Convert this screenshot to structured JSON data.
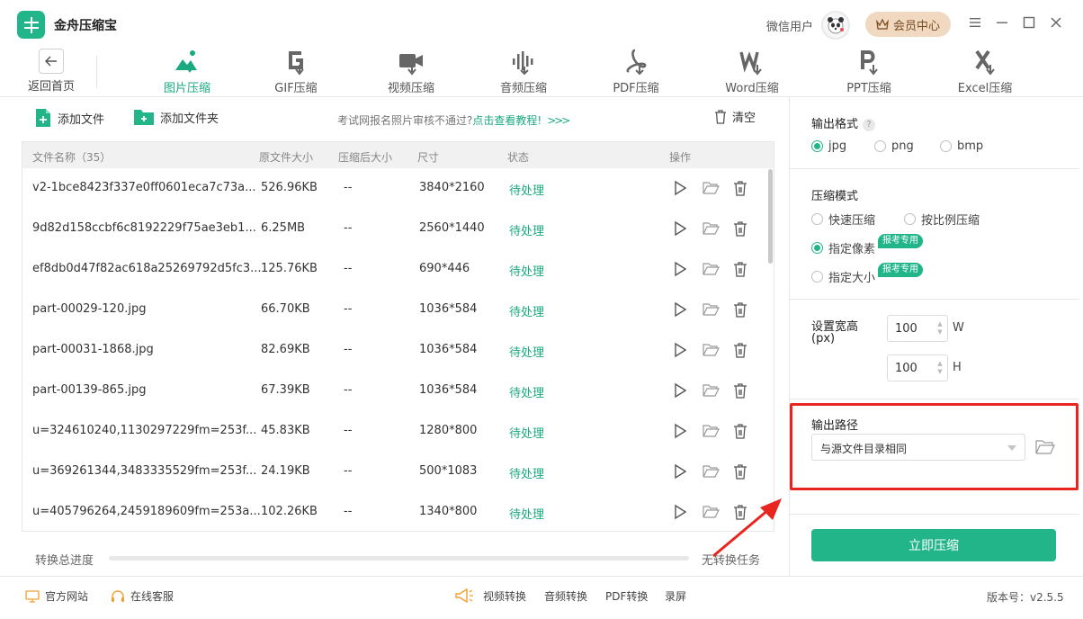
{
  "app": {
    "title": "金舟压缩宝",
    "user_name": "微信用户",
    "vip_label": "会员中心"
  },
  "nav": {
    "back_label": "返回首页",
    "tabs": [
      {
        "label": "图片压缩",
        "icon": "image-compress-icon",
        "active": true
      },
      {
        "label": "GIF压缩",
        "icon": "gif-compress-icon"
      },
      {
        "label": "视频压缩",
        "icon": "video-compress-icon"
      },
      {
        "label": "音频压缩",
        "icon": "audio-compress-icon"
      },
      {
        "label": "PDF压缩",
        "icon": "pdf-compress-icon"
      },
      {
        "label": "Word压缩",
        "icon": "word-compress-icon"
      },
      {
        "label": "PPT压缩",
        "icon": "ppt-compress-icon"
      },
      {
        "label": "Excel压缩",
        "icon": "excel-compress-icon"
      }
    ]
  },
  "toolbar": {
    "add_file": "添加文件",
    "add_folder": "添加文件夹",
    "notice_text": "考试网报名照片审核不通过?",
    "notice_link": "点击查看教程!",
    "notice_arrows": ">>>",
    "clear": "清空"
  },
  "table": {
    "headers": {
      "name": "文件名称（35）",
      "original_size": "原文件大小",
      "compressed_size": "压缩后大小",
      "dimensions": "尺寸",
      "status": "状态",
      "actions": "操作"
    },
    "rows": [
      {
        "name": "v2-1bce8423f337e0ff0601eca7c73a...",
        "original_size": "526.96KB",
        "compressed_size": "--",
        "dimensions": "3840*2160",
        "status": "待处理"
      },
      {
        "name": "9d82d158ccbf6c8192229f75ae3eb1...",
        "original_size": "6.25MB",
        "compressed_size": "--",
        "dimensions": "2560*1440",
        "status": "待处理"
      },
      {
        "name": "ef8db0d47f82ac618a25269792d5fc3...",
        "original_size": "125.76KB",
        "compressed_size": "--",
        "dimensions": "690*446",
        "status": "待处理"
      },
      {
        "name": "part-00029-120.jpg",
        "original_size": "66.70KB",
        "compressed_size": "--",
        "dimensions": "1036*584",
        "status": "待处理"
      },
      {
        "name": "part-00031-1868.jpg",
        "original_size": "82.69KB",
        "compressed_size": "--",
        "dimensions": "1036*584",
        "status": "待处理"
      },
      {
        "name": "part-00139-865.jpg",
        "original_size": "67.39KB",
        "compressed_size": "--",
        "dimensions": "1036*584",
        "status": "待处理"
      },
      {
        "name": "u=324610240,1130297229fm=253f...",
        "original_size": "45.83KB",
        "compressed_size": "--",
        "dimensions": "1280*800",
        "status": "待处理"
      },
      {
        "name": "u=369261344,3483335529fm=253f...",
        "original_size": "24.19KB",
        "compressed_size": "--",
        "dimensions": "500*1083",
        "status": "待处理"
      },
      {
        "name": "u=405796264,2459189609fm=253a...",
        "original_size": "102.26KB",
        "compressed_size": "--",
        "dimensions": "1340*800",
        "status": "待处理"
      }
    ]
  },
  "progress": {
    "label": "转换总进度",
    "status": "无转换任务",
    "value": 0
  },
  "settings": {
    "output_format": {
      "title": "输出格式",
      "help": "?",
      "options": [
        "jpg",
        "png",
        "bmp"
      ],
      "selected": "jpg"
    },
    "compress_mode": {
      "title": "压缩模式",
      "options": [
        "快速压缩",
        "按比例压缩",
        "指定像素",
        "指定大小"
      ],
      "selected": "指定像素",
      "badge": "报考专用"
    },
    "size": {
      "title_line1": "设置宽高",
      "title_line2": "(px)",
      "width": "100",
      "height": "100",
      "width_unit": "W",
      "height_unit": "H"
    },
    "output_path": {
      "title": "输出路径",
      "selected": "与源文件目录相同"
    },
    "compress_button": "立即压缩"
  },
  "footer": {
    "website": "官方网站",
    "support": "在线客服",
    "links": [
      "视频转换",
      "音频转换",
      "PDF转换",
      "录屏"
    ],
    "version": "版本号：v2.5.5"
  },
  "colors": {
    "accent": "#22b58a",
    "highlight": "#e8251f",
    "vip_bg": "#f0d9c0"
  }
}
